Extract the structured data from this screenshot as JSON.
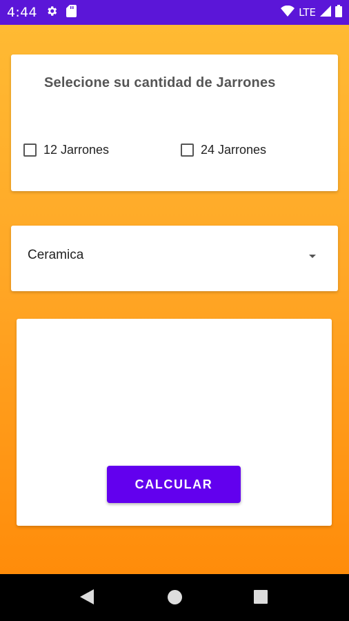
{
  "status_bar": {
    "time": "4:44",
    "network": "LTE",
    "icons": [
      "gear-icon",
      "sd-card-icon",
      "wifi-icon",
      "signal-icon",
      "battery-icon"
    ],
    "background_color": "#5b16d8"
  },
  "quantity_card": {
    "title": "Selecione su cantidad de Jarrones",
    "options": [
      {
        "label": "12 Jarrones",
        "checked": false
      },
      {
        "label": "24 Jarrones",
        "checked": false
      }
    ]
  },
  "material_select": {
    "selected": "Ceramica"
  },
  "result_card": {
    "button_label": "CALCULAR",
    "button_color": "#6200ee"
  },
  "nav_bar": {
    "icons": [
      "back-icon",
      "home-icon",
      "recents-icon"
    ]
  },
  "colors": {
    "gradient_top": "#ffba33",
    "gradient_bottom": "#ff8c0a"
  }
}
